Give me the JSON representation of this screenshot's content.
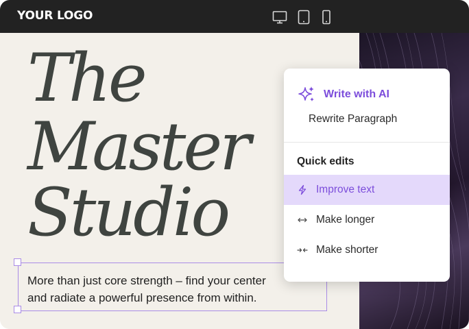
{
  "header": {
    "logo": "YOUR LOGO",
    "devices": [
      "desktop-icon",
      "tablet-icon",
      "mobile-icon"
    ]
  },
  "canvas": {
    "headline_lines": [
      "The",
      "Master",
      "Studio"
    ],
    "body_lines": [
      "More than just core strength – find your center",
      "and radiate a powerful presence from within."
    ]
  },
  "popup": {
    "write_with_ai": "Write with AI",
    "rewrite": "Rewrite Paragraph",
    "quick_edits_title": "Quick edits",
    "items": [
      {
        "label": "Improve text",
        "icon": "lightning-icon",
        "active": true
      },
      {
        "label": "Make longer",
        "icon": "expand-arrows-icon",
        "active": false
      },
      {
        "label": "Make shorter",
        "icon": "shrink-arrows-icon",
        "active": false
      }
    ]
  },
  "colors": {
    "accent": "#7c4ddb",
    "highlight": "#e4d9fb",
    "topbar": "#222222",
    "canvas_bg": "#f3f0ea"
  }
}
